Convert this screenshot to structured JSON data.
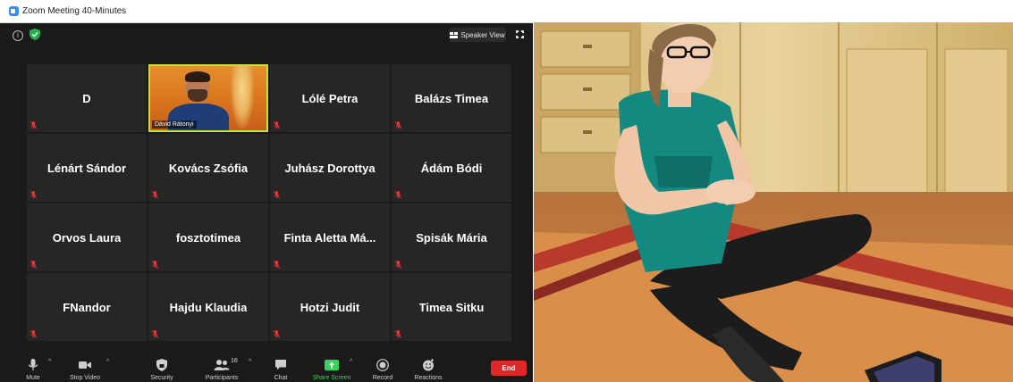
{
  "window": {
    "title": "Zoom Meeting 40-Minutes"
  },
  "topbar": {
    "speaker_view_label": "Speaker View"
  },
  "participants": [
    {
      "name": "D",
      "video": false
    },
    {
      "name": "Dávid Rátonyi",
      "video": true
    },
    {
      "name": "Lólé Petra",
      "video": false
    },
    {
      "name": "Balázs Timea",
      "video": false
    },
    {
      "name": "Lénárt Sándor",
      "video": false
    },
    {
      "name": "Kovács Zsófia",
      "video": false
    },
    {
      "name": "Juhász Dorottya",
      "video": false
    },
    {
      "name": "Ádám Bódi",
      "video": false
    },
    {
      "name": "Orvos Laura",
      "video": false
    },
    {
      "name": "fosztotimea",
      "video": false
    },
    {
      "name": "Finta Aletta Má...",
      "video": false
    },
    {
      "name": "Spisák Mária",
      "video": false
    },
    {
      "name": "FNandor",
      "video": false
    },
    {
      "name": "Hajdu Klaudia",
      "video": false
    },
    {
      "name": "Hotzi Judit",
      "video": false
    },
    {
      "name": "Timea Sitku",
      "video": false
    }
  ],
  "toolbar": {
    "mute": "Mute",
    "stop_video": "Stop Video",
    "security": "Security",
    "participants": "Participants",
    "participants_count": "16",
    "chat": "Chat",
    "share_screen": "Share Screen",
    "record": "Record",
    "reactions": "Reactions",
    "end": "End"
  },
  "colors": {
    "active_speaker_border": "#c6e03a",
    "share_green": "#36d35b",
    "end_red": "#e02828",
    "tile_bg": "#262626"
  }
}
